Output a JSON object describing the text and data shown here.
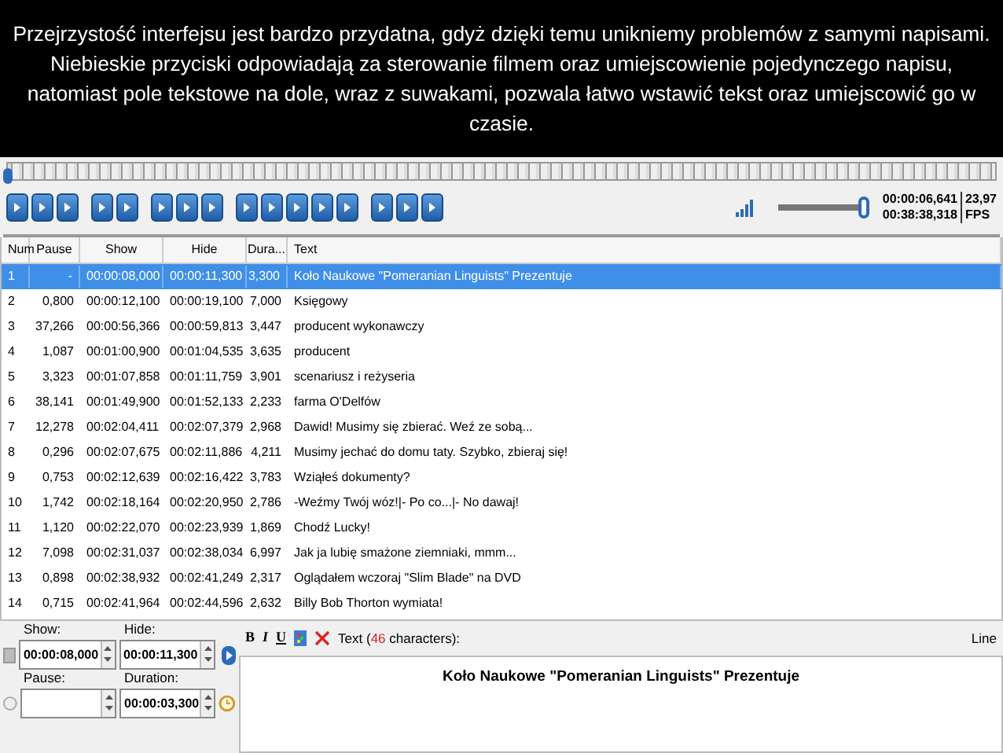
{
  "caption": "Przejrzystość interfejsu jest bardzo przydatna, gdyż dzięki temu unikniemy problemów z samymi napisami. Niebieskie przyciski odpowiadają za sterowanie filmem oraz umiejscowienie pojedynczego napisu, natomiast pole tekstowe na dole, wraz z suwakami, pozwala łatwo wstawić tekst oraz umiejscowić go w czasie.",
  "player": {
    "position": {
      "level": 0.0
    },
    "volume": {
      "level": 1.0
    },
    "current_time": "00:00:06,641",
    "total_time": "00:38:38,318",
    "fps_value": "23,97",
    "fps_label": "FPS"
  },
  "table": {
    "columns": [
      "Num",
      "Pause",
      "Show",
      "Hide",
      "Dura...",
      "Text"
    ],
    "rows": [
      {
        "cells": [
          "1",
          "-",
          "00:00:08,000",
          "00:00:11,300",
          "3,300",
          "Koło Naukowe \"Pomeranian Linguists\" Prezentuje"
        ],
        "selected": true
      },
      {
        "cells": [
          "2",
          "0,800",
          "00:00:12,100",
          "00:00:19,100",
          "7,000",
          "Księgowy"
        ],
        "selected": false
      },
      {
        "cells": [
          "3",
          "37,266",
          "00:00:56,366",
          "00:00:59,813",
          "3,447",
          "producent wykonawczy"
        ],
        "selected": false
      },
      {
        "cells": [
          "4",
          "1,087",
          "00:01:00,900",
          "00:01:04,535",
          "3,635",
          "producent"
        ],
        "selected": false
      },
      {
        "cells": [
          "5",
          "3,323",
          "00:01:07,858",
          "00:01:11,759",
          "3,901",
          "scenariusz i reżyseria"
        ],
        "selected": false
      },
      {
        "cells": [
          "6",
          "38,141",
          "00:01:49,900",
          "00:01:52,133",
          "2,233",
          "farma O'Delfów"
        ],
        "selected": false
      },
      {
        "cells": [
          "7",
          "12,278",
          "00:02:04,411",
          "00:02:07,379",
          "2,968",
          "Dawid! Musimy się zbierać. Weź ze sobą..."
        ],
        "selected": false
      },
      {
        "cells": [
          "8",
          "0,296",
          "00:02:07,675",
          "00:02:11,886",
          "4,211",
          "Musimy jechać do domu taty. Szybko, zbieraj się!"
        ],
        "selected": false
      },
      {
        "cells": [
          "9",
          "0,753",
          "00:02:12,639",
          "00:02:16,422",
          "3,783",
          "Wziąłeś dokumenty?"
        ],
        "selected": false
      },
      {
        "cells": [
          "10",
          "1,742",
          "00:02:18,164",
          "00:02:20,950",
          "2,786",
          "-Weźmy Twój wóz!|- Po co...|- No dawaj!"
        ],
        "selected": false
      },
      {
        "cells": [
          "11",
          "1,120",
          "00:02:22,070",
          "00:02:23,939",
          "1,869",
          "Chodź Lucky!"
        ],
        "selected": false
      },
      {
        "cells": [
          "12",
          "7,098",
          "00:02:31,037",
          "00:02:38,034",
          "6,997",
          "Jak ja lubię smażone ziemniaki, mmm..."
        ],
        "selected": false
      },
      {
        "cells": [
          "13",
          "0,898",
          "00:02:38,932",
          "00:02:41,249",
          "2,317",
          "Oglądałem wczoraj \"Slim Blade\" na DVD"
        ],
        "selected": false
      },
      {
        "cells": [
          "14",
          "0,715",
          "00:02:41,964",
          "00:02:44,596",
          "2,632",
          "Billy Bob Thorton wymiata!"
        ],
        "selected": false
      }
    ]
  },
  "editor": {
    "show_label": "Show:",
    "show_value": "00:00:08,000",
    "hide_label": "Hide:",
    "hide_value": "00:00:11,300",
    "pause_label": "Pause:",
    "duration_label": "Duration:",
    "duration_value": "00:00:03,300",
    "bold_label": "B",
    "italic_label": "I",
    "underline_label": "U",
    "text_label_start": "Text (",
    "char_count": "46",
    "text_label_end": "characters):",
    "lines_label": "Line",
    "subtitle_text": "Koło Naukowe \"Pomeranian Linguists\" Prezentuje"
  }
}
